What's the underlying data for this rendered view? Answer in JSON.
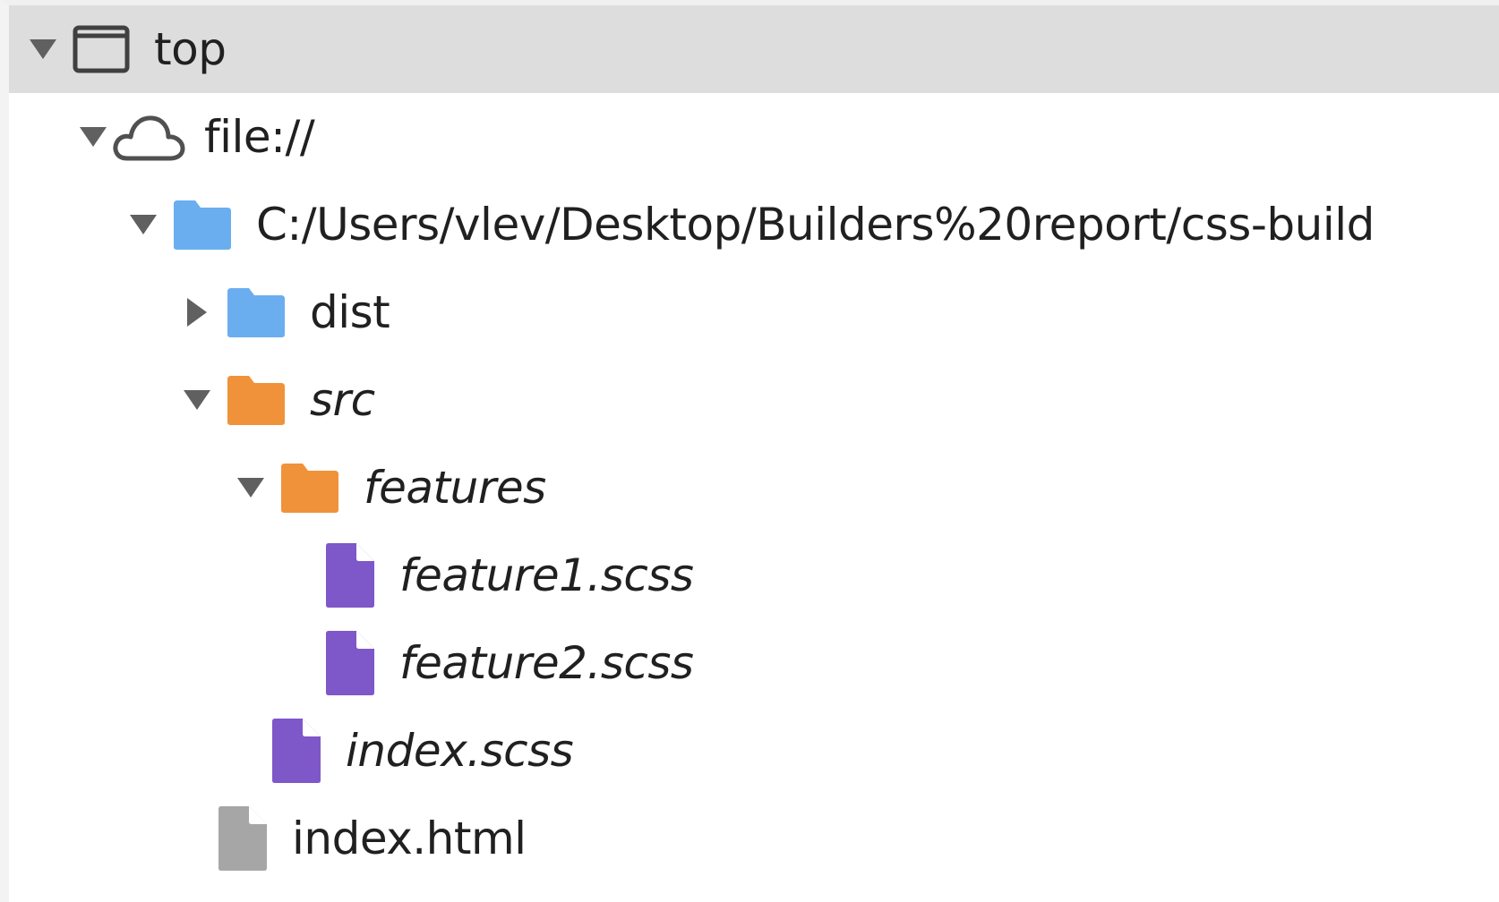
{
  "tree": {
    "rows": [
      {
        "label": "top",
        "icon": "frame-icon",
        "expanded": true,
        "italic": false,
        "selected": true
      },
      {
        "label": "file://",
        "icon": "cloud-icon",
        "expanded": true,
        "italic": false,
        "selected": false
      },
      {
        "label": "C:/Users/vlev/Desktop/Builders%20report/css-build",
        "icon": "folder-icon",
        "expanded": true,
        "italic": false,
        "selected": false
      },
      {
        "label": "dist",
        "icon": "folder-icon",
        "expanded": false,
        "italic": false,
        "selected": false
      },
      {
        "label": "src",
        "icon": "folder-icon",
        "expanded": true,
        "italic": true,
        "selected": false
      },
      {
        "label": "features",
        "icon": "folder-icon",
        "expanded": true,
        "italic": true,
        "selected": false
      },
      {
        "label": "feature1.scss",
        "icon": "stylesheet-file-icon",
        "expanded": null,
        "italic": true,
        "selected": false
      },
      {
        "label": "feature2.scss",
        "icon": "stylesheet-file-icon",
        "expanded": null,
        "italic": true,
        "selected": false
      },
      {
        "label": "index.scss",
        "icon": "stylesheet-file-icon",
        "expanded": null,
        "italic": true,
        "selected": false
      },
      {
        "label": "index.html",
        "icon": "document-file-icon",
        "expanded": null,
        "italic": false,
        "selected": false
      }
    ]
  },
  "colors": {
    "selected_bg": "#dddddd",
    "folder_blue": "#6aaef0",
    "folder_orange": "#f0923a",
    "stylesheet_purple": "#7e57c8",
    "document_gray": "#a6a6a6",
    "arrow": "#606060",
    "text": "#202020"
  }
}
